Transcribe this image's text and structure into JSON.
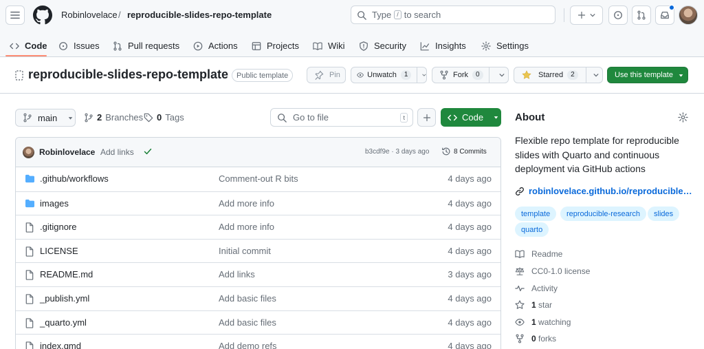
{
  "header": {
    "owner": "Robinlovelace",
    "separator": "/",
    "repo": "reproducible-slides-repo-template",
    "search_before": "Type",
    "search_key": "/",
    "search_after": "to search"
  },
  "tabs": [
    {
      "label": "Code",
      "icon": "code-icon",
      "active": true
    },
    {
      "label": "Issues",
      "icon": "issue-icon"
    },
    {
      "label": "Pull requests",
      "icon": "pull-request-icon"
    },
    {
      "label": "Actions",
      "icon": "play-icon"
    },
    {
      "label": "Projects",
      "icon": "table-icon"
    },
    {
      "label": "Wiki",
      "icon": "book-icon"
    },
    {
      "label": "Security",
      "icon": "shield-icon"
    },
    {
      "label": "Insights",
      "icon": "graph-icon"
    },
    {
      "label": "Settings",
      "icon": "gear-icon"
    }
  ],
  "repo": {
    "title": "reproducible-slides-repo-template",
    "visibility": "Public template",
    "pin": "Pin",
    "unwatch": "Unwatch",
    "watch_count": "1",
    "fork": "Fork",
    "fork_count": "0",
    "starred": "Starred",
    "star_count": "2",
    "use_template": "Use this template"
  },
  "toolbar": {
    "branch": "main",
    "branches_count": "2",
    "branches_label": "Branches",
    "tags_count": "0",
    "tags_label": "Tags",
    "go_to_file": "Go to file",
    "go_to_file_key": "t",
    "code": "Code"
  },
  "commit": {
    "author": "Robinlovelace",
    "message": "Add links",
    "hash_time": "b3cdf9e · 3 days ago",
    "commits": "8 Commits"
  },
  "files": [
    {
      "name": ".github/workflows",
      "type": "folder",
      "message": "Comment-out R bits",
      "date": "4 days ago"
    },
    {
      "name": "images",
      "type": "folder",
      "message": "Add more info",
      "date": "4 days ago"
    },
    {
      "name": ".gitignore",
      "type": "file",
      "message": "Add more info",
      "date": "4 days ago"
    },
    {
      "name": "LICENSE",
      "type": "file",
      "message": "Initial commit",
      "date": "4 days ago"
    },
    {
      "name": "README.md",
      "type": "file",
      "message": "Add links",
      "date": "3 days ago"
    },
    {
      "name": "_publish.yml",
      "type": "file",
      "message": "Add basic files",
      "date": "4 days ago"
    },
    {
      "name": "_quarto.yml",
      "type": "file",
      "message": "Add basic files",
      "date": "4 days ago"
    },
    {
      "name": "index.qmd",
      "type": "file",
      "message": "Add demo refs",
      "date": "4 days ago"
    }
  ],
  "about": {
    "title": "About",
    "description": "Flexible repo template for reproducible slides with Quarto and continuous deployment via GitHub actions",
    "link": "robinlovelace.github.io/reproducible-slides-repo-template/",
    "topics": [
      "template",
      "reproducible-research",
      "slides",
      "quarto"
    ],
    "readme": "Readme",
    "license": "CC0-1.0 license",
    "activity": "Activity",
    "stars_count": "1",
    "stars_label": "star",
    "watching_count": "1",
    "watching_label": "watching",
    "forks_count": "0",
    "forks_label": "forks"
  },
  "colors": {
    "accent": "#0969da",
    "primary_button": "#1f883d",
    "active_tab_underline": "#fd8c73",
    "star": "#eac54f",
    "folder": "#54aeff"
  }
}
